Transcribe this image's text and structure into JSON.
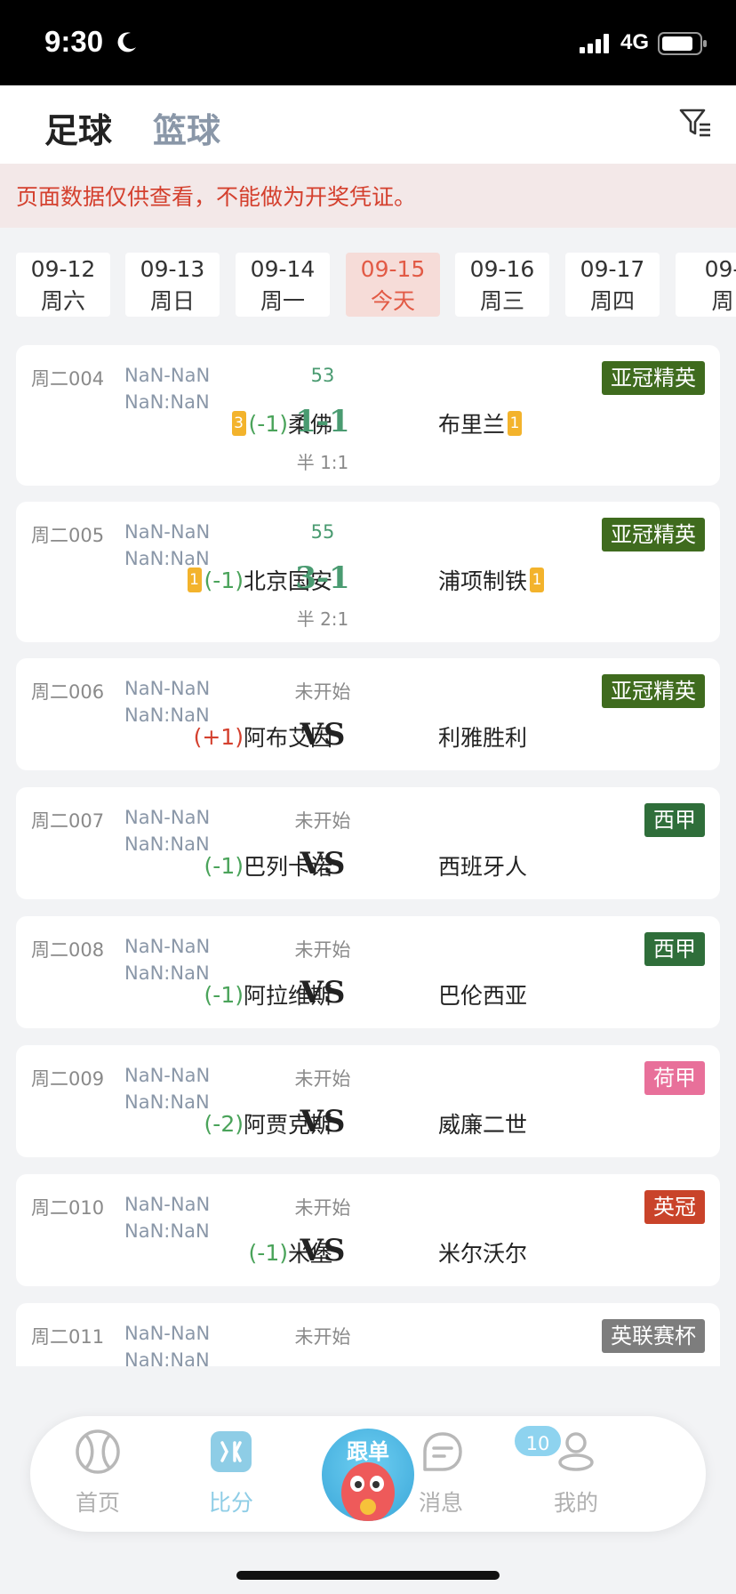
{
  "status_bar": {
    "time": "9:30",
    "network": "4G"
  },
  "header": {
    "tabs": [
      "足球",
      "篮球"
    ]
  },
  "notice": "页面数据仅供查看，不能做为开奖凭证。",
  "dates": [
    {
      "date": "09-12",
      "day": "周六"
    },
    {
      "date": "09-13",
      "day": "周日"
    },
    {
      "date": "09-14",
      "day": "周一"
    },
    {
      "date": "09-15",
      "day": "今天",
      "active": true
    },
    {
      "date": "09-16",
      "day": "周三"
    },
    {
      "date": "09-17",
      "day": "周四"
    },
    {
      "date": "09-",
      "day": "周"
    }
  ],
  "matches": [
    {
      "num": "周二004",
      "time1": "NaN-NaN",
      "time2": "NaN:NaN",
      "status": "53",
      "home_rc": "3",
      "handicap": "(-1)",
      "home": "柔佛",
      "score": "1-1",
      "half": "半 1:1",
      "away": "布里兰",
      "away_rc": "1",
      "league": "亚冠精英",
      "league_color": "#3f6b1e"
    },
    {
      "num": "周二005",
      "time1": "NaN-NaN",
      "time2": "NaN:NaN",
      "status": "55",
      "home_rc": "1",
      "handicap": "(-1)",
      "home": "北京国安",
      "score": "3-1",
      "half": "半 2:1",
      "away": "浦项制铁",
      "away_rc": "1",
      "league": "亚冠精英",
      "league_color": "#3f6b1e"
    },
    {
      "num": "周二006",
      "time1": "NaN-NaN",
      "time2": "NaN:NaN",
      "status": "未开始",
      "handicap": "(+1)",
      "home": "阿布艾因",
      "score": "VS",
      "away": "利雅胜利",
      "league": "亚冠精英",
      "league_color": "#3f6b1e"
    },
    {
      "num": "周二007",
      "time1": "NaN-NaN",
      "time2": "NaN:NaN",
      "status": "未开始",
      "handicap": "(-1)",
      "home": "巴列卡诺",
      "score": "VS",
      "away": "西班牙人",
      "league": "西甲",
      "league_color": "#2f6e3a"
    },
    {
      "num": "周二008",
      "time1": "NaN-NaN",
      "time2": "NaN:NaN",
      "status": "未开始",
      "handicap": "(-1)",
      "home": "阿拉维斯",
      "score": "VS",
      "away": "巴伦西亚",
      "league": "西甲",
      "league_color": "#2f6e3a"
    },
    {
      "num": "周二009",
      "time1": "NaN-NaN",
      "time2": "NaN:NaN",
      "status": "未开始",
      "handicap": "(-2)",
      "home": "阿贾克斯",
      "score": "VS",
      "away": "威廉二世",
      "league": "荷甲",
      "league_color": "#e8709a"
    },
    {
      "num": "周二010",
      "time1": "NaN-NaN",
      "time2": "NaN:NaN",
      "status": "未开始",
      "handicap": "(-1)",
      "home": "米堡",
      "score": "VS",
      "away": "米尔沃尔",
      "league": "英冠",
      "league_color": "#c9432a"
    },
    {
      "num": "周二011",
      "time1": "NaN-NaN",
      "time2": "NaN:NaN",
      "status": "未开始",
      "handicap": "",
      "home": "",
      "score": "",
      "away": "",
      "league": "英联赛杯",
      "league_color": "#7d7d7d"
    }
  ],
  "bottom_nav": {
    "items": [
      "首页",
      "比分",
      "跟单",
      "消息",
      "我的"
    ],
    "badge": "10"
  }
}
